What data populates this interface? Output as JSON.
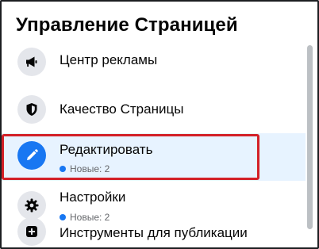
{
  "panel": {
    "title": "Управление Страницей",
    "items": [
      {
        "label": "Центр рекламы",
        "icon": "megaphone-icon"
      },
      {
        "label": "Качество Страницы",
        "icon": "shield-icon"
      },
      {
        "label": "Редактировать",
        "icon": "pencil-icon",
        "badge": "Новые: 2",
        "selected": true
      },
      {
        "label": "Настройки",
        "icon": "gear-icon",
        "badge": "Новые: 2"
      },
      {
        "label": "Инструменты для публикации",
        "icon": "plus-square-icon"
      }
    ]
  },
  "colors": {
    "selected_background": "#e7f3ff",
    "accent": "#1877f2",
    "highlight_border": "#d32027",
    "icon_background": "#e4e6eb"
  }
}
